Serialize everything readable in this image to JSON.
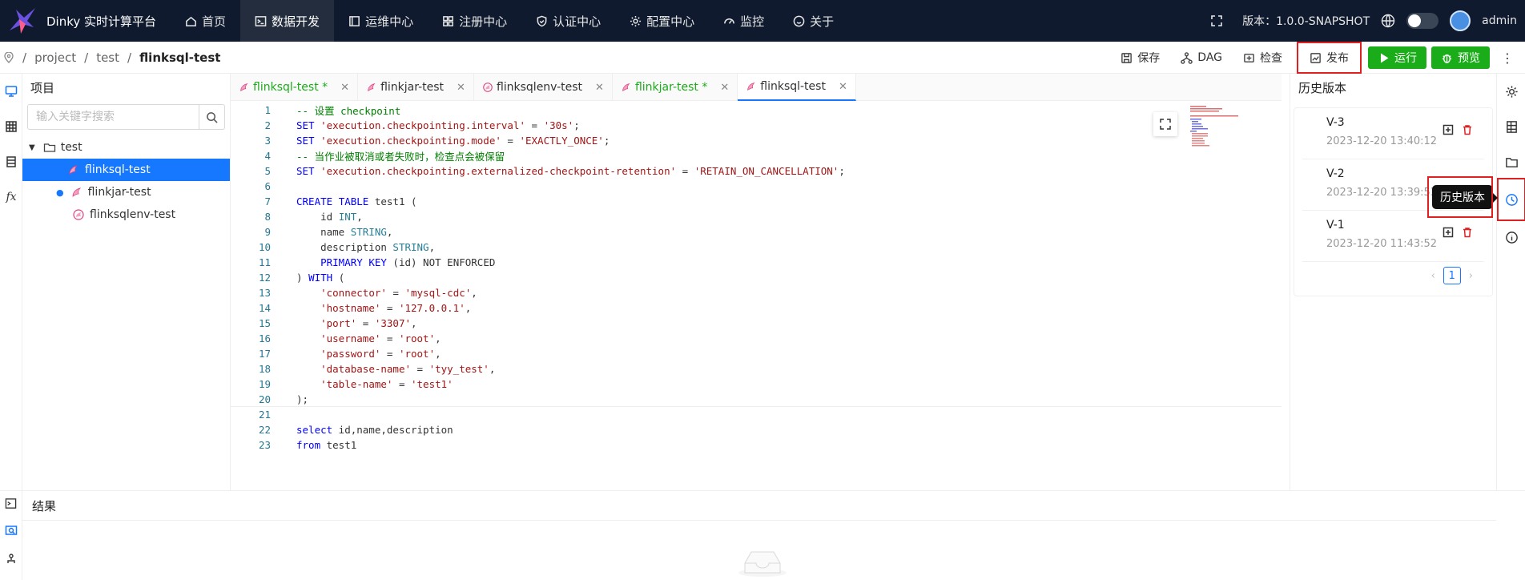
{
  "app": {
    "brand": "Dinky 实时计算平台",
    "nav": [
      {
        "label": "首页",
        "icon": "home-icon"
      },
      {
        "label": "数据开发",
        "icon": "terminal-icon",
        "active": true
      },
      {
        "label": "运维中心",
        "icon": "ops-icon"
      },
      {
        "label": "注册中心",
        "icon": "grid-icon"
      },
      {
        "label": "认证中心",
        "icon": "shield-icon"
      },
      {
        "label": "配置中心",
        "icon": "gear-icon"
      },
      {
        "label": "监控",
        "icon": "dashboard-icon"
      },
      {
        "label": "关于",
        "icon": "smile-icon"
      }
    ],
    "version": "版本：1.0.0-SNAPSHOT",
    "user": "admin"
  },
  "breadcrumb": {
    "sep": "/",
    "items": [
      "project",
      "test",
      "flinksql-test"
    ]
  },
  "toolbar": {
    "save": "保存",
    "dag": "DAG",
    "check": "检查",
    "publish": "发布",
    "run": "运行",
    "preview": "预览"
  },
  "project": {
    "title": "项目",
    "search_placeholder": "输入关键字搜索",
    "tree": [
      {
        "label": "test",
        "type": "folder"
      },
      {
        "label": "flinksql-test",
        "type": "file",
        "selected": true
      },
      {
        "label": "flinkjar-test",
        "type": "file",
        "dot": true
      },
      {
        "label": "flinksqlenv-test",
        "type": "file"
      }
    ]
  },
  "tabs": [
    {
      "label": "flinksql-test *",
      "modified": true
    },
    {
      "label": "flinkjar-test",
      "modified": false
    },
    {
      "label": "flinksqlenv-test",
      "modified": false
    },
    {
      "label": "flinkjar-test *",
      "modified": true
    },
    {
      "label": "flinksql-test",
      "modified": false,
      "active": true
    }
  ],
  "code_lines": [
    "-- 设置 checkpoint",
    "SET 'execution.checkpointing.interval' = '30s';",
    "SET 'execution.checkpointing.mode' = 'EXACTLY_ONCE';",
    "-- 当作业被取消或者失败时，检查点会被保留",
    "SET 'execution.checkpointing.externalized-checkpoint-retention' = 'RETAIN_ON_CANCELLATION';",
    "",
    "CREATE TABLE test1 (",
    "    id INT,",
    "    name STRING,",
    "    description STRING,",
    "    PRIMARY KEY (id) NOT ENFORCED",
    ") WITH (",
    "    'connector' = 'mysql-cdc',",
    "    'hostname' = '127.0.0.1',",
    "    'port' = '3307',",
    "    'username' = 'root',",
    "    'password' = 'root',",
    "    'database-name' = 'tyy_test',",
    "    'table-name' = 'test1'",
    ");",
    "",
    "select id,name,description",
    "from test1"
  ],
  "history": {
    "title": "历史版本",
    "versions": [
      {
        "ver": "V-3",
        "time": "2023-12-20 13:40:12"
      },
      {
        "ver": "V-2",
        "time": "2023-12-20 13:39:53"
      },
      {
        "ver": "V-1",
        "time": "2023-12-20 11:43:52"
      }
    ],
    "page": "1",
    "tooltip": "历史版本"
  },
  "result": {
    "title": "结果"
  },
  "colors": {
    "accent": "#1677ff",
    "run": "#1aad19",
    "highlight": "#e02020",
    "topbar": "#0f1a2e"
  }
}
